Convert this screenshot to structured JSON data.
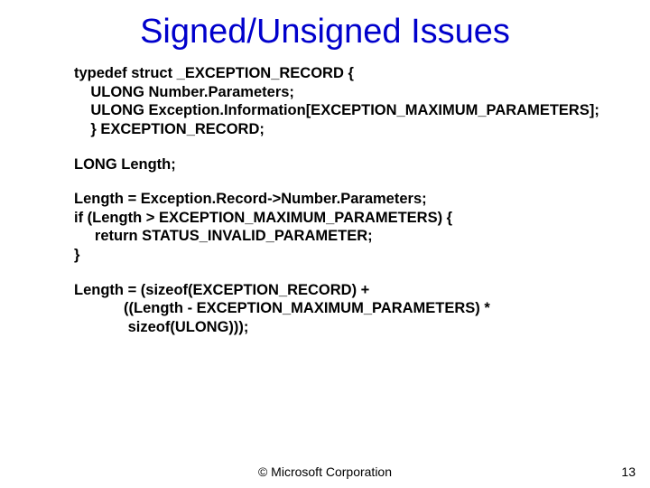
{
  "title": "Signed/Unsigned Issues",
  "code": {
    "block1": {
      "l1": "typedef struct _EXCEPTION_RECORD {",
      "l2": "    ULONG Number.Parameters;",
      "l3_a": "    ULONG",
      "l3_b": "Exception.Information[EXCEPTION_MAXIMUM_PARAMETERS];",
      "l4": "    } EXCEPTION_RECORD;"
    },
    "block2": {
      "l1": "LONG Length;"
    },
    "block3": {
      "l1": "Length = Exception.Record->Number.Parameters;",
      "l2": "if (Length > EXCEPTION_MAXIMUM_PARAMETERS) {",
      "l3": "     return STATUS_INVALID_PARAMETER;",
      "l4": "}"
    },
    "block4": {
      "l1": "Length = (sizeof(EXCEPTION_RECORD) +",
      "l2": "            ((Length - EXCEPTION_MAXIMUM_PARAMETERS) *",
      "l3": "             sizeof(ULONG)));"
    }
  },
  "footer": {
    "copyright": "© Microsoft Corporation",
    "page": "13"
  }
}
